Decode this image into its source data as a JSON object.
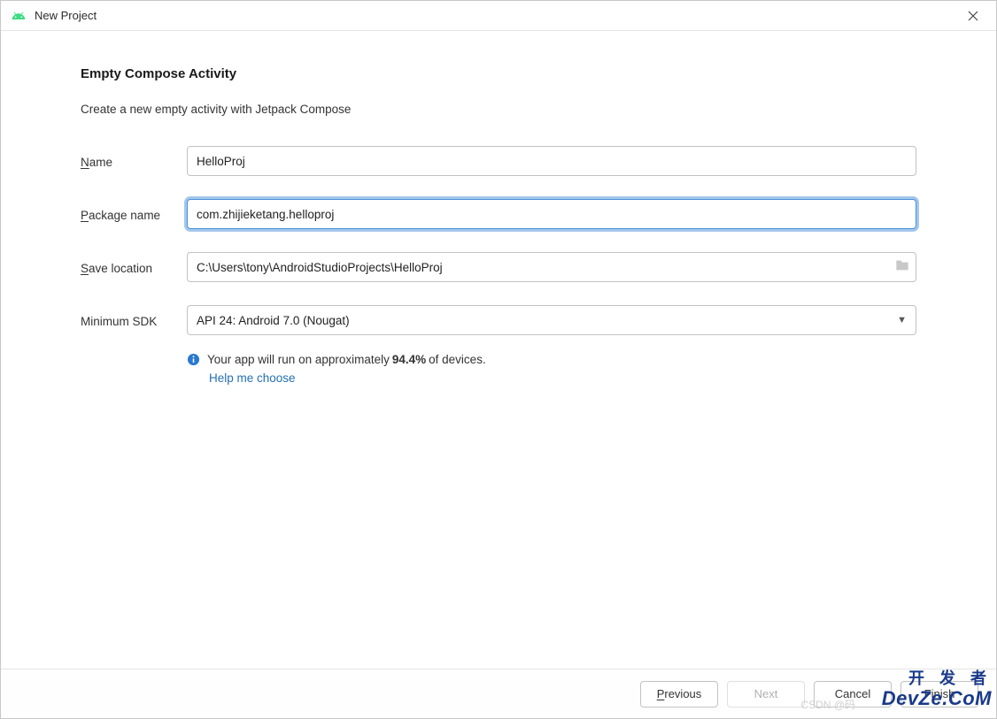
{
  "window": {
    "title": "New Project"
  },
  "main": {
    "heading": "Empty Compose Activity",
    "subheading": "Create a new empty activity with Jetpack Compose"
  },
  "form": {
    "name": {
      "label_pre": "N",
      "label_post": "ame",
      "value": "HelloProj"
    },
    "package": {
      "label_pre": "P",
      "label_post": "ackage name",
      "value": "com.zhijieketang.helloproj"
    },
    "save": {
      "label_pre": "S",
      "label_post": "ave location",
      "value": "C:\\Users\\tony\\AndroidStudioProjects\\HelloProj"
    },
    "minsdk": {
      "label": "Minimum SDK",
      "value": "API 24: Android 7.0 (Nougat)"
    }
  },
  "info": {
    "pre": "Your app will run on approximately ",
    "pct": "94.4%",
    "post": " of devices.",
    "help": "Help me choose"
  },
  "buttons": {
    "previous_pre": "P",
    "previous_post": "revious",
    "next": "Next",
    "cancel": "Cancel",
    "finish": "Finish"
  },
  "watermark": {
    "csdn": "CSDN @码",
    "cn": "开 发 者",
    "brand": "DevZe.CoM"
  }
}
